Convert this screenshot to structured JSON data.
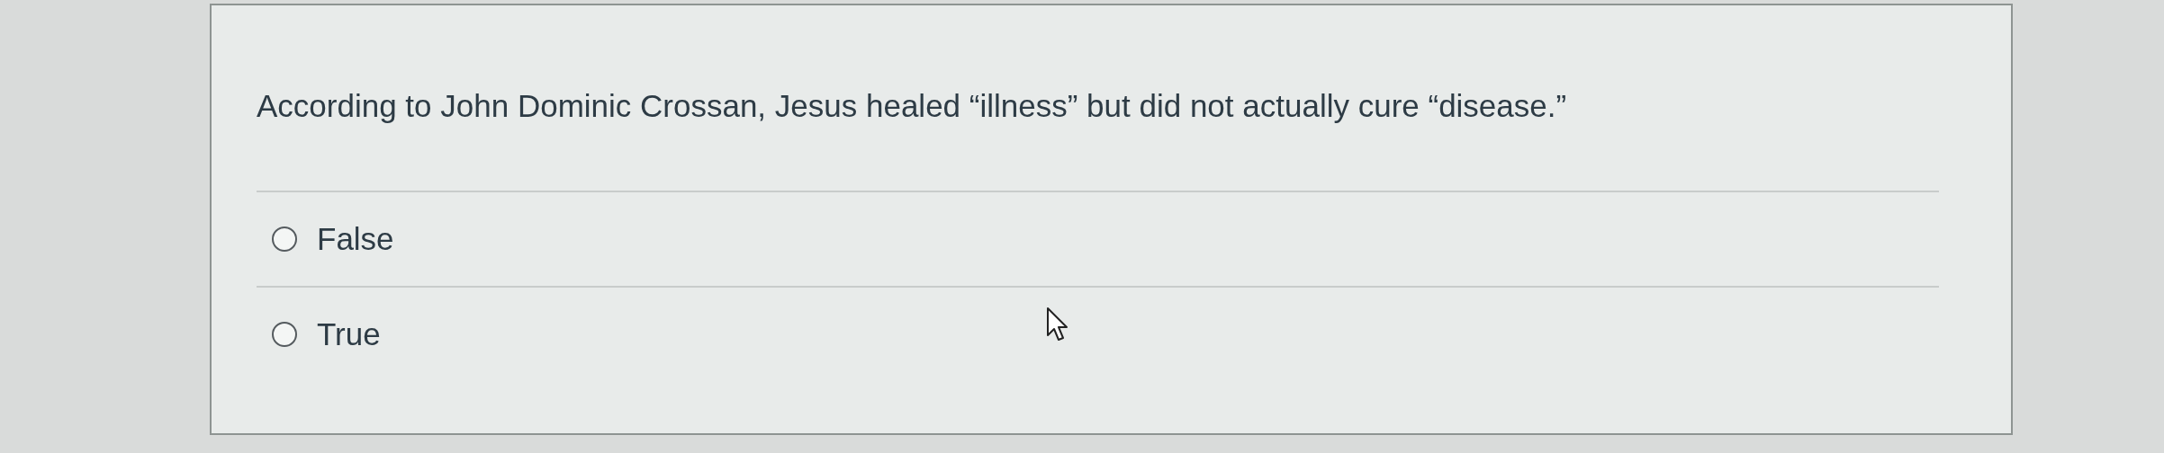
{
  "question": {
    "text": "According to John Dominic Crossan, Jesus healed “illness” but did not actually cure “disease.”"
  },
  "options": [
    {
      "label": "False",
      "selected": false
    },
    {
      "label": "True",
      "selected": false
    }
  ]
}
